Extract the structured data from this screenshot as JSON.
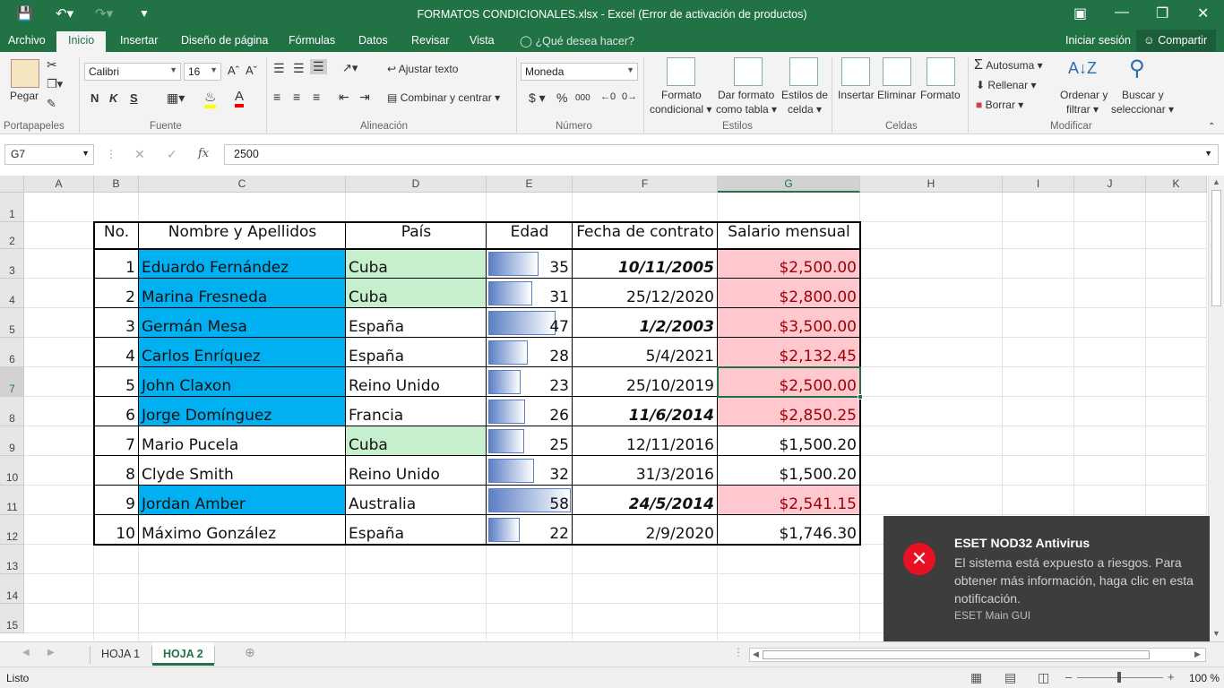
{
  "window": {
    "title": "FORMATOS CONDICIONALES.xlsx - Excel (Error de activación de productos)"
  },
  "ribbon_tabs": [
    "Archivo",
    "Inicio",
    "Insertar",
    "Diseño de página",
    "Fórmulas",
    "Datos",
    "Revisar",
    "Vista"
  ],
  "tell_me": "¿Qué desea hacer?",
  "account": {
    "signin": "Iniciar sesión",
    "share": "Compartir"
  },
  "ribbon": {
    "clipboard": {
      "paste": "Pegar",
      "label": "Portapapeles"
    },
    "font": {
      "name": "Calibri",
      "size": "16",
      "bold": "N",
      "italic": "K",
      "underline": "S",
      "label": "Fuente"
    },
    "alignment": {
      "wrap": "Ajustar texto",
      "merge": "Combinar y centrar",
      "label": "Alineación"
    },
    "number": {
      "format": "Moneda",
      "currency": "$",
      "percent": "%",
      "thousands": "000",
      "label": "Número"
    },
    "styles": {
      "conditional_1": "Formato",
      "conditional_2": "condicional",
      "table_1": "Dar formato",
      "table_2": "como tabla",
      "cell_1": "Estilos de",
      "cell_2": "celda",
      "label": "Estilos"
    },
    "cells": {
      "insert": "Insertar",
      "delete": "Eliminar",
      "format": "Formato",
      "label": "Celdas"
    },
    "editing": {
      "autosum": "Autosuma",
      "fill": "Rellenar",
      "clear": "Borrar",
      "sort_1": "Ordenar y",
      "sort_2": "filtrar",
      "find_1": "Buscar y",
      "find_2": "seleccionar",
      "label": "Modificar"
    }
  },
  "formula_bar": {
    "name_box": "G7",
    "fx": "fx",
    "value": "2500"
  },
  "columns": [
    "A",
    "B",
    "C",
    "D",
    "E",
    "F",
    "G",
    "H",
    "I",
    "J",
    "K"
  ],
  "rows": [
    "1",
    "2",
    "3",
    "4",
    "5",
    "6",
    "7",
    "8",
    "9",
    "10",
    "11",
    "12",
    "13",
    "14",
    "15"
  ],
  "table": {
    "headers": [
      "No.",
      "Nombre y Apellidos",
      "País",
      "Edad",
      "Fecha de contrato",
      "Salario mensual"
    ],
    "rows": [
      {
        "no": "1",
        "name": "Eduardo Fernández",
        "country": "Cuba",
        "age": 35,
        "date": "10/11/2005",
        "salary": "$2,500.00",
        "name_hl": true,
        "country_hl": true,
        "date_em": true,
        "salary_hl": true
      },
      {
        "no": "2",
        "name": "Marina Fresneda",
        "country": "Cuba",
        "age": 31,
        "date": "25/12/2020",
        "salary": "$2,800.00",
        "name_hl": true,
        "country_hl": true,
        "date_em": false,
        "salary_hl": true
      },
      {
        "no": "3",
        "name": "Germán Mesa",
        "country": "España",
        "age": 47,
        "date": "1/2/2003",
        "salary": "$3,500.00",
        "name_hl": true,
        "country_hl": false,
        "date_em": true,
        "salary_hl": true
      },
      {
        "no": "4",
        "name": "Carlos Enríquez",
        "country": "España",
        "age": 28,
        "date": "5/4/2021",
        "salary": "$2,132.45",
        "name_hl": true,
        "country_hl": false,
        "date_em": false,
        "salary_hl": true
      },
      {
        "no": "5",
        "name": "John Claxon",
        "country": "Reino Unido",
        "age": 23,
        "date": "25/10/2019",
        "salary": "$2,500.00",
        "name_hl": true,
        "country_hl": false,
        "date_em": false,
        "salary_hl": true
      },
      {
        "no": "6",
        "name": "Jorge Domínguez",
        "country": "Francia",
        "age": 26,
        "date": "11/6/2014",
        "salary": "$2,850.25",
        "name_hl": true,
        "country_hl": false,
        "date_em": true,
        "salary_hl": true
      },
      {
        "no": "7",
        "name": "Mario Pucela",
        "country": "Cuba",
        "age": 25,
        "date": "12/11/2016",
        "salary": "$1,500.20",
        "name_hl": false,
        "country_hl": true,
        "date_em": false,
        "salary_hl": false
      },
      {
        "no": "8",
        "name": "Clyde Smith",
        "country": "Reino Unido",
        "age": 32,
        "date": "31/3/2016",
        "salary": "$1,500.20",
        "name_hl": false,
        "country_hl": false,
        "date_em": false,
        "salary_hl": false
      },
      {
        "no": "9",
        "name": "Jordan Amber",
        "country": "Australia",
        "age": 58,
        "date": "24/5/2014",
        "salary": "$2,541.15",
        "name_hl": true,
        "country_hl": false,
        "date_em": true,
        "salary_hl": true
      },
      {
        "no": "10",
        "name": "Máximo González",
        "country": "España",
        "age": 22,
        "date": "2/9/2020",
        "salary": "$1,746.30",
        "name_hl": false,
        "country_hl": false,
        "date_em": false,
        "salary_hl": false
      }
    ]
  },
  "databar_max": 58,
  "colors": {
    "excel_green": "#217346",
    "name_fill": "#00b0f0",
    "country_fill": "#c6efce",
    "salary_fill": "#ffc7ce",
    "salary_text": "#9c0006",
    "bar": "#5b7fc4"
  },
  "sheets": [
    {
      "name": "HOJA 1",
      "active": false
    },
    {
      "name": "HOJA 2",
      "active": true
    }
  ],
  "status": {
    "ready": "Listo",
    "zoom": "100 %"
  },
  "notification": {
    "title": "ESET NOD32 Antivirus",
    "message": "El sistema está expuesto a riesgos. Para obtener más información, haga clic en esta notificación.",
    "source": "ESET Main GUI"
  }
}
